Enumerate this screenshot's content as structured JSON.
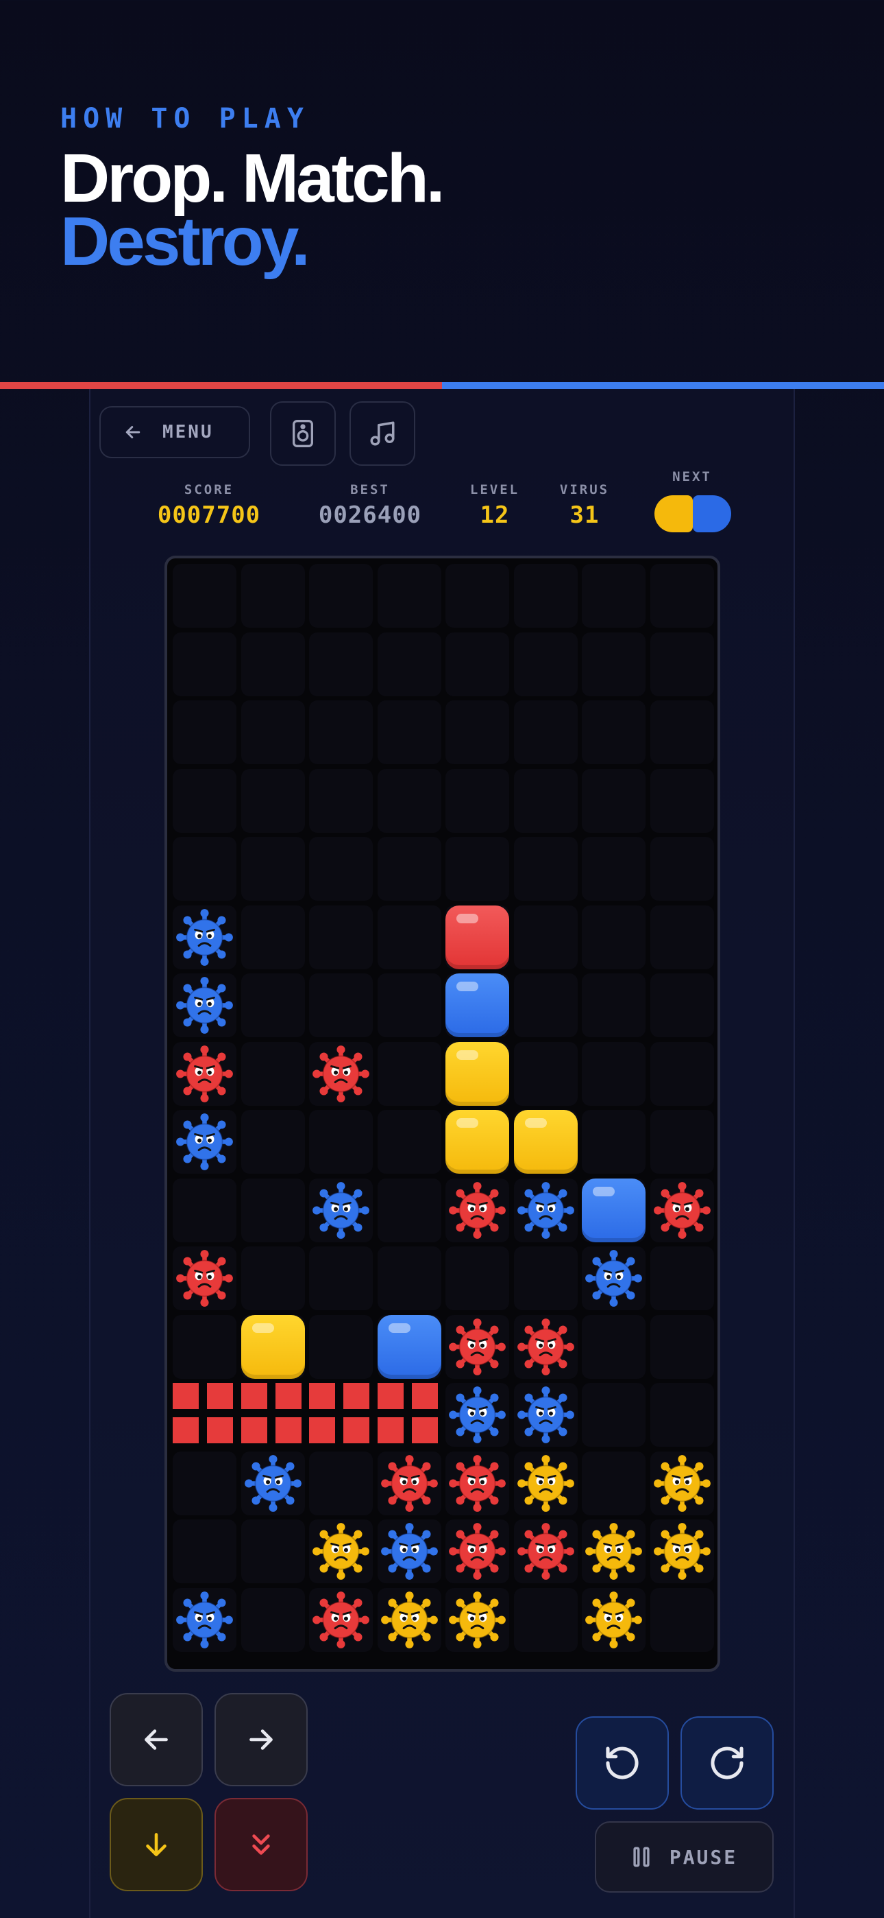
{
  "header": {
    "kicker": "HOW TO PLAY",
    "line1": "Drop. Match.",
    "line2": "Destroy."
  },
  "progress": {
    "value": 0.5,
    "fill_color": "#e04545",
    "track_color": "#3d7ef0"
  },
  "top_bar": {
    "menu_label": "MENU",
    "menu_icon": "arrow-left-icon",
    "sound_icon": "speaker-icon",
    "music_icon": "music-note-icon"
  },
  "stats": {
    "score_label": "SCORE",
    "score": "0007700",
    "best_label": "BEST",
    "best": "0026400",
    "level_label": "LEVEL",
    "level": "12",
    "virus_label": "VIRUS",
    "virus": "31",
    "next_label": "NEXT",
    "next_colors": [
      "yellow",
      "blue"
    ]
  },
  "colors": {
    "red": "#e23434",
    "blue": "#2b6ae6",
    "yellow": "#f5b90c",
    "accent": "#3d7ef0"
  },
  "board": {
    "cols": 8,
    "rows": 16,
    "legend": {
      ".": "empty",
      "R": "red-block",
      "B": "blue-block",
      "Y": "yellow-block",
      "r": "red-virus",
      "b": "blue-virus",
      "y": "yellow-virus",
      "#": "red-brick-wall"
    },
    "grid": [
      "........",
      "........",
      "........",
      "........",
      "........",
      "b...R...",
      "b...B...",
      "r.r.Y...",
      "b...YY..",
      "..b.rbBr",
      "r.....b.",
      ".Y.Brr..",
      "####bb..",
      ".b.rry.y",
      "..ybrryy",
      "b.ryy.y."
    ]
  },
  "controls": {
    "left_icon": "arrow-left-icon",
    "right_icon": "arrow-right-icon",
    "down_icon": "arrow-down-icon",
    "drop_icon": "double-chevron-down-icon",
    "rotate_ccw_icon": "rotate-ccw-icon",
    "rotate_cw_icon": "rotate-cw-icon",
    "pause_icon": "pause-icon",
    "pause_label": "PAUSE"
  }
}
